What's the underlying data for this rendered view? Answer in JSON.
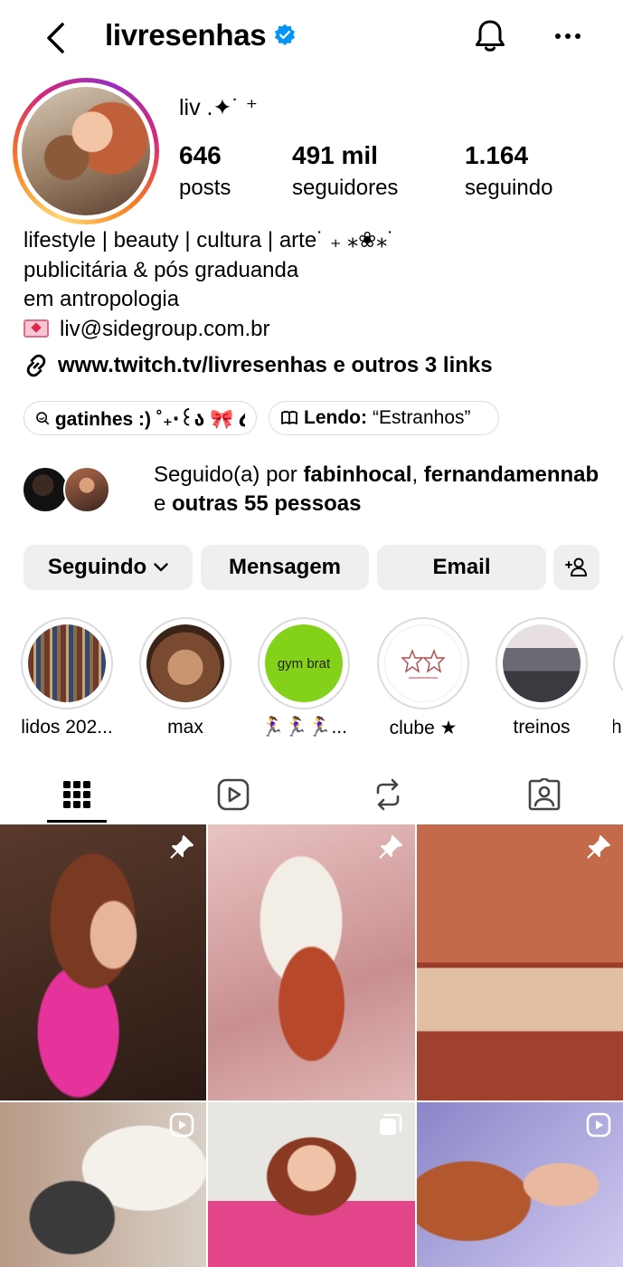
{
  "header": {
    "username": "livresenhas",
    "verified": true
  },
  "profile": {
    "display_name": "liv .✦˙ ⁺",
    "stats": [
      {
        "value": "646",
        "label": "posts"
      },
      {
        "value": "491 mil",
        "label": "seguidores"
      },
      {
        "value": "1.164",
        "label": "seguindo"
      }
    ],
    "bio_lines": [
      "lifestyle | beauty | cultura | arte˙ ₊ ⁎❀⁎˙",
      "publicitária & pós graduanda",
      "em antropologia",
      "liv@sidegroup.com.br"
    ],
    "link": "www.twitch.tv/livresenhas e outros 3 links"
  },
  "chips": [
    {
      "icon": "threads-icon",
      "text": "gatinhes :) ˚₊‧꒰ა 🎀 ໒꒱ ‧₊˚"
    },
    {
      "icon": "book-icon",
      "label": "Lendo:",
      "text": "“Estranhos”"
    }
  ],
  "followed_by": {
    "prefix": "Seguido(a) por ",
    "user1": "fabinhocal",
    "sep": ",",
    "user2": "fernandamennab",
    "middle": " e ",
    "others": "outras 55 pessoas"
  },
  "buttons": {
    "following": "Seguindo",
    "message": "Mensagem",
    "email": "Email"
  },
  "highlights": [
    {
      "label": "lidos 202..."
    },
    {
      "label": "max"
    },
    {
      "label": "🏃‍♀️🏃‍♀️🏃‍♀️...",
      "inner_text": "gym brat"
    },
    {
      "label": "clube ★"
    },
    {
      "label": "treinos"
    },
    {
      "label": "h"
    }
  ],
  "tabs": [
    "grid-icon",
    "reels-icon",
    "reposts-icon",
    "tagged-icon"
  ],
  "colors": {
    "verified_blue": "#0095f6",
    "button_bg": "#efefef",
    "gym_brat_green": "#84d11a"
  }
}
